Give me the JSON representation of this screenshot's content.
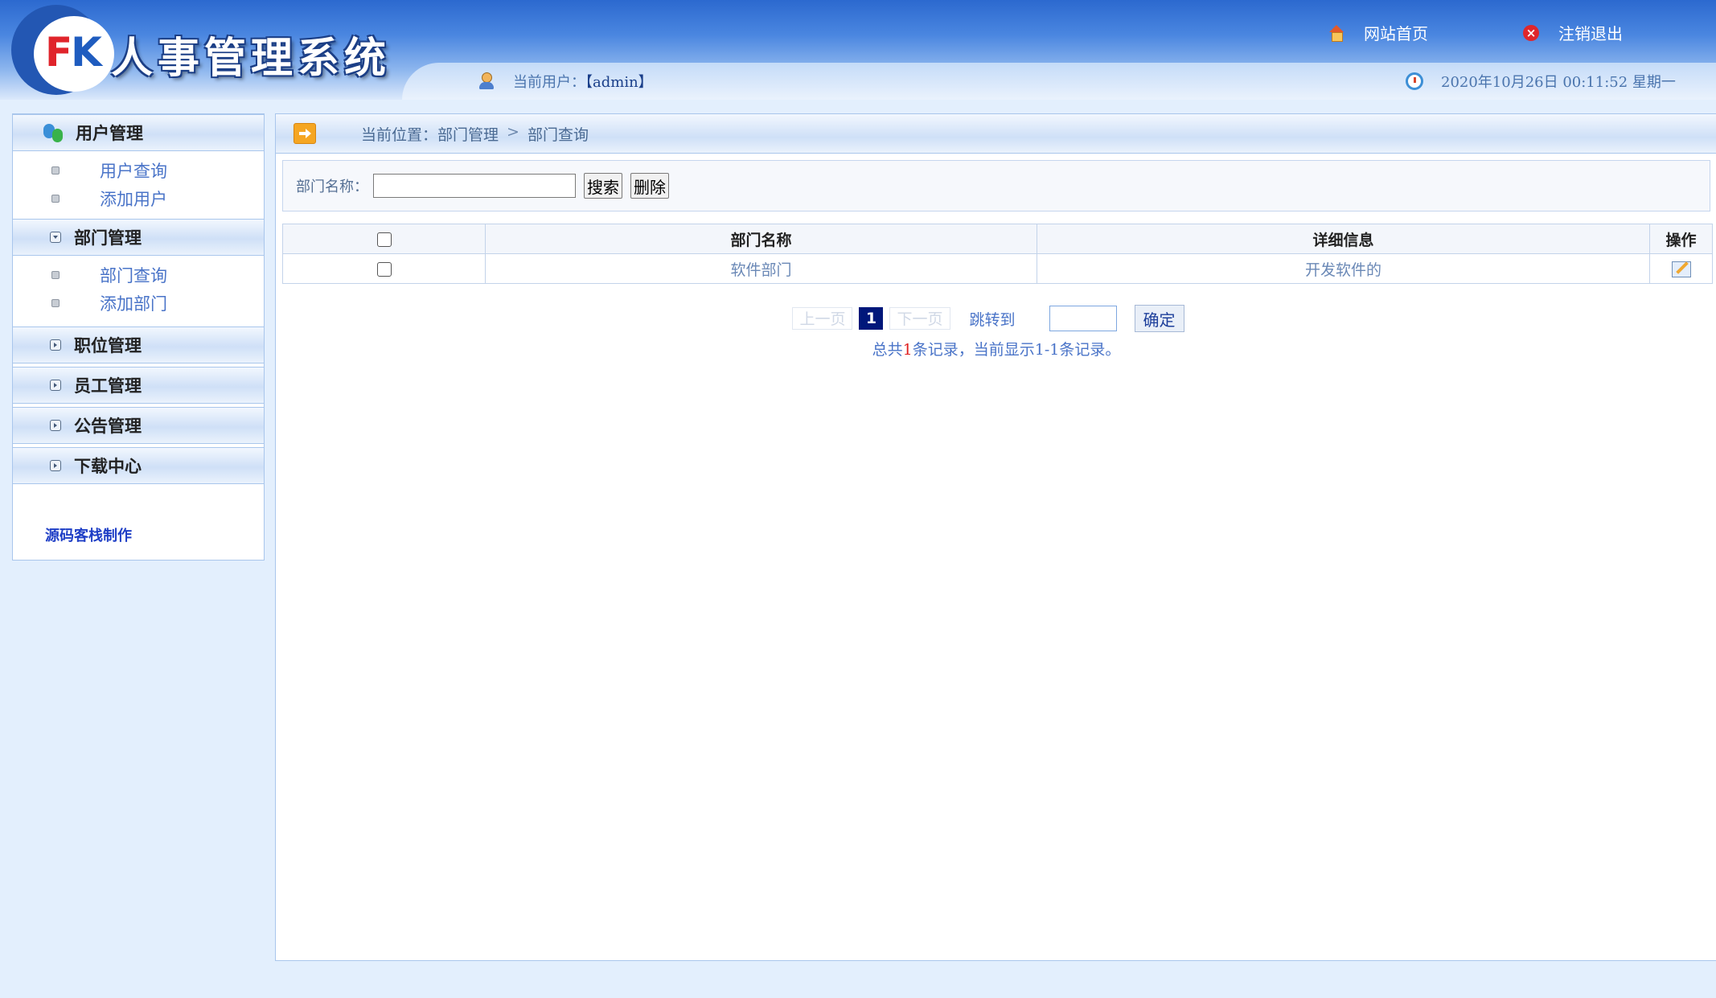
{
  "header": {
    "logo_f": "F",
    "logo_k": "K",
    "title": "人事管理系统",
    "links": {
      "home": "网站首页",
      "logout": "注销退出"
    },
    "current_user_label": "当前用户：",
    "current_user": "【admin】",
    "datetime": "2020年10月26日 00:11:52 星期一"
  },
  "sidebar": {
    "groups": [
      {
        "label": "用户管理",
        "items": [
          "用户查询",
          "添加用户"
        ]
      },
      {
        "label": "部门管理",
        "items": [
          "部门查询",
          "添加部门"
        ]
      },
      {
        "label": "职位管理"
      },
      {
        "label": "员工管理"
      },
      {
        "label": "公告管理"
      },
      {
        "label": "下载中心"
      }
    ],
    "credit": "源码客栈制作"
  },
  "main": {
    "breadcrumb": {
      "label": "当前位置：",
      "section": "部门管理",
      "sep": ">",
      "page": "部门查询"
    },
    "search": {
      "label": "部门名称：",
      "value": "",
      "search_btn": "搜索",
      "delete_btn": "删除"
    },
    "table": {
      "columns": [
        "部门名称",
        "详细信息",
        "操作"
      ],
      "rows": [
        {
          "name": "软件部门",
          "detail": "开发软件的"
        }
      ]
    },
    "pager": {
      "prev": "上一页",
      "current": "1",
      "next": "下一页",
      "jump_label": "跳转到",
      "jump_value": "",
      "confirm": "确定",
      "summary_pre": "总共",
      "summary_count": "1",
      "summary_post": "条记录，当前显示1-1条记录。"
    }
  }
}
